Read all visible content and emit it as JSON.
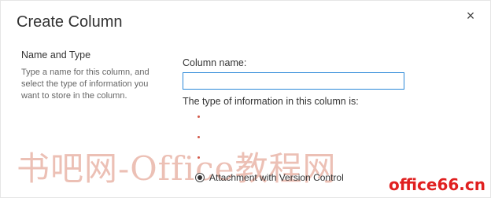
{
  "dialog": {
    "title": "Create Column",
    "close_glyph": "×"
  },
  "section": {
    "title": "Name and Type",
    "description": "Type a name for this column, and select the type of information you want to store in the column."
  },
  "form": {
    "column_name_label": "Column name:",
    "column_name_value": "",
    "type_label": "The type of information in this column is:",
    "selected_option": "Attachment with Version Control"
  },
  "watermark": {
    "text": "书吧网-Office教程网",
    "corner_text": "office66.cn"
  }
}
